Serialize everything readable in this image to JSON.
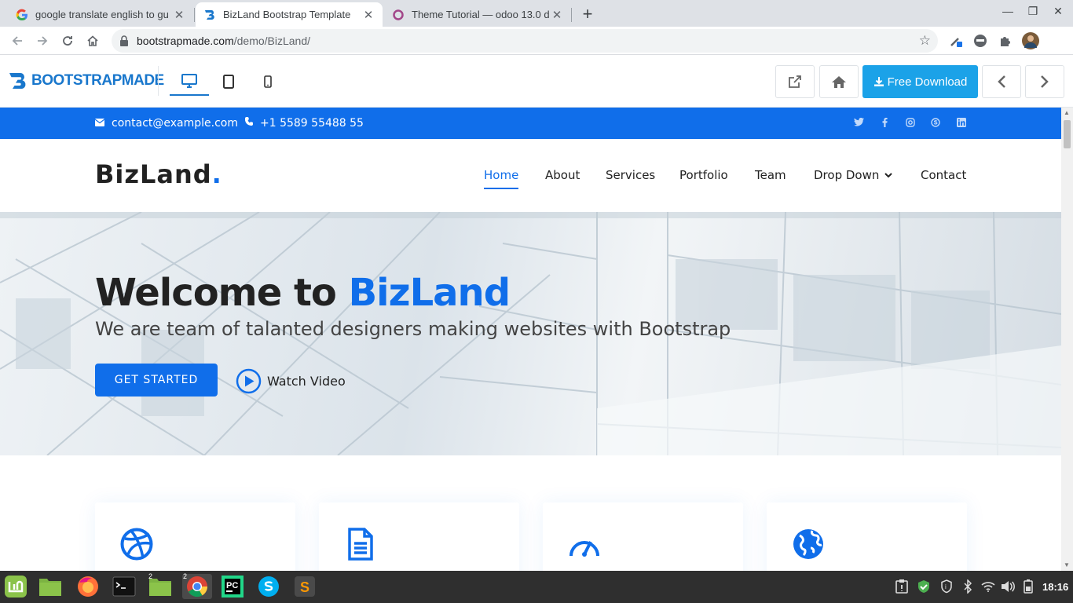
{
  "browser": {
    "tabs": [
      {
        "title": "google translate english to gu",
        "favicon": "google-icon"
      },
      {
        "title": "BizLand Bootstrap Template",
        "favicon": "bootstrapmade-icon",
        "active": true
      },
      {
        "title": "Theme Tutorial — odoo 13.0 d",
        "favicon": "odoo-icon"
      }
    ],
    "url_host": "bootstrapmade.com",
    "url_path": "/demo/BizLand/"
  },
  "bootstrapmade": {
    "logo": "BOOTSTRAPMADE",
    "download_label": "Free Download"
  },
  "site": {
    "email": "contact@example.com",
    "phone": "+1 5589 55488 55",
    "brand": "BizLand",
    "brand_dot": ".",
    "nav": [
      "Home",
      "About",
      "Services",
      "Portfolio",
      "Team",
      "Drop Down",
      "Contact"
    ],
    "hero_title_prefix": "Welcome to ",
    "hero_title_highlight": "BizLand",
    "hero_subtitle": "We are team of talanted designers making websites with Bootstrap",
    "cta_label": "GET STARTED",
    "watch_label": "Watch Video"
  },
  "taskbar": {
    "clock": "18:16",
    "badges": {
      "files2": "2",
      "chrome": "2"
    }
  },
  "colors": {
    "accent": "#106eea",
    "download": "#1ba2e8",
    "bm_brand": "#1977cc"
  }
}
